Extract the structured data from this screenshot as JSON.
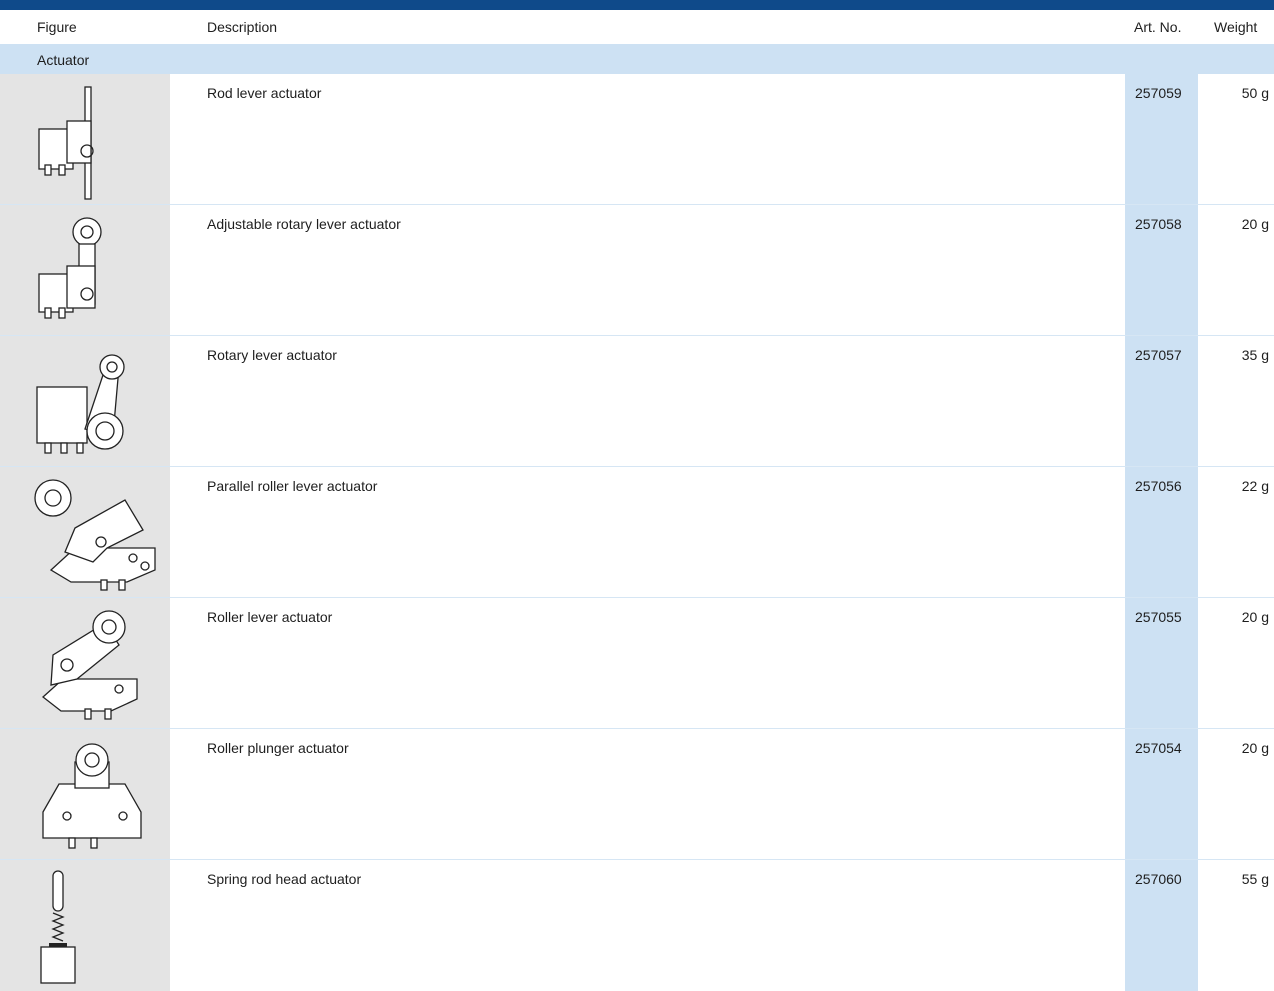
{
  "header": {
    "figure": "Figure",
    "description": "Description",
    "art_no": "Art. No.",
    "weight": "Weight"
  },
  "section": {
    "label": "Actuator"
  },
  "colors": {
    "topbar": "#0f4a8a",
    "section_bg": "#cde1f3",
    "figure_bg": "#e4e4e4"
  },
  "rows": [
    {
      "description": "Rod lever actuator",
      "art_no": "257059",
      "weight": "50 g",
      "icon": "rod-lever-actuator-icon"
    },
    {
      "description": "Adjustable rotary lever actuator",
      "art_no": "257058",
      "weight": "20 g",
      "icon": "adjustable-rotary-lever-actuator-icon"
    },
    {
      "description": "Rotary lever actuator",
      "art_no": "257057",
      "weight": "35 g",
      "icon": "rotary-lever-actuator-icon"
    },
    {
      "description": "Parallel roller lever actuator",
      "art_no": "257056",
      "weight": "22 g",
      "icon": "parallel-roller-lever-actuator-icon"
    },
    {
      "description": "Roller lever actuator",
      "art_no": "257055",
      "weight": "20 g",
      "icon": "roller-lever-actuator-icon"
    },
    {
      "description": "Roller plunger actuator",
      "art_no": "257054",
      "weight": "20 g",
      "icon": "roller-plunger-actuator-icon"
    },
    {
      "description": "Spring rod head actuator",
      "art_no": "257060",
      "weight": "55 g",
      "icon": "spring-rod-head-actuator-icon"
    }
  ]
}
